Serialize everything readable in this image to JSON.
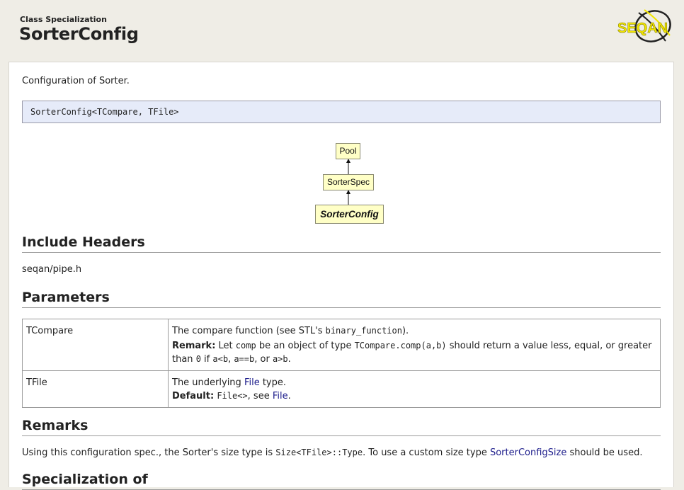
{
  "header": {
    "kind": "Class Specialization",
    "title": "SorterConfig",
    "logo_text": "SEQAN"
  },
  "intro": "Configuration of Sorter.",
  "signature": "SorterConfig<TCompare, TFile>",
  "diagram": {
    "nodes": [
      "Pool",
      "SorterSpec",
      "SorterConfig"
    ]
  },
  "sections": {
    "include_headers": "Include Headers",
    "parameters": "Parameters",
    "remarks": "Remarks",
    "specialization_of": "Specialization of"
  },
  "include_path": "seqan/pipe.h",
  "params": [
    {
      "name": "TCompare",
      "desc_prefix": "The compare function (see STL's ",
      "desc_code": "binary_function",
      "desc_suffix": ").",
      "remark_label": "Remark:",
      "remark_1": " Let ",
      "remark_code_1": "comp",
      "remark_2": " be an object of type ",
      "remark_code_2": "TCompare.comp(a,b)",
      "remark_3": " should return a value less, equal, or greater than ",
      "remark_code_3": "0",
      "remark_4": " if ",
      "remark_code_4": "a<b",
      "remark_5": ", ",
      "remark_code_5": "a==b",
      "remark_6": ", or ",
      "remark_code_6": "a>b",
      "remark_7": "."
    },
    {
      "name": "TFile",
      "desc_prefix": "The underlying ",
      "desc_link": "File",
      "desc_suffix": " type.",
      "default_label": "Default:",
      "default_code": "File<>",
      "default_mid": ", see ",
      "default_link": "File",
      "default_end": "."
    }
  ],
  "remarks": {
    "t1": "Using this configuration spec., the Sorter's size type is ",
    "code": "Size<TFile>::Type",
    "t2": ". To use a custom size type ",
    "link": "SorterConfigSize",
    "t3": " should be used."
  },
  "colors": {
    "background": "#efede6",
    "signature_bg": "#e6ebf9",
    "node_bg": "#ffffc6",
    "link": "#1a1a8a",
    "logo_yellow": "#f2e600"
  }
}
